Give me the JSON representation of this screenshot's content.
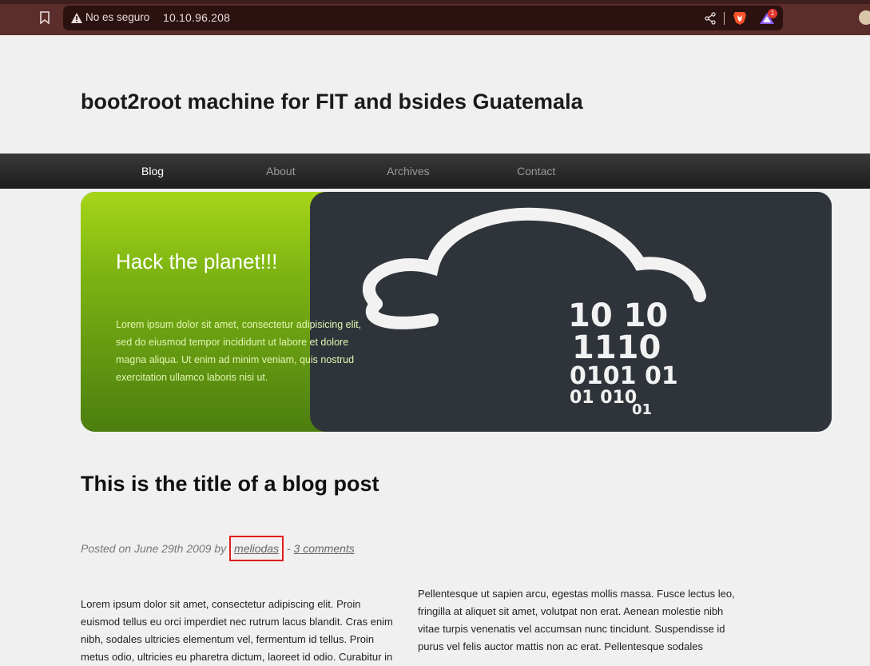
{
  "browser": {
    "security_label": "No es seguro",
    "url": "10.10.96.208",
    "rewards_count": "1"
  },
  "site": {
    "title": "boot2root machine for FIT and bsides Guatemala"
  },
  "nav": {
    "items": [
      {
        "label": "Blog",
        "active": true
      },
      {
        "label": "About"
      },
      {
        "label": "Archives"
      },
      {
        "label": "Contact"
      }
    ]
  },
  "banner": {
    "title": "Hack the planet!!!",
    "text": "Lorem ipsum dolor sit amet, consectetur adipisicing elit, sed do eiusmod tempor incididunt ut labore et dolore magna aliqua. Ut enim ad minim veniam, quis nostrud exercitation ullamco laboris nisi ut.",
    "binary_lines": [
      "10   10",
      "1110",
      "0101   01",
      "01         010",
      "01"
    ],
    "colors": {
      "green_top": "#a6d619",
      "green_bottom": "#4c7e10",
      "dark": "#2f343a"
    }
  },
  "post": {
    "title": "This is the title of a blog post",
    "meta_prefix": "Posted on June 29th 2009 by",
    "author": "meliodas",
    "separator": "-",
    "comments_label": "3 comments",
    "col1": "Lorem ipsum dolor sit amet, consectetur adipiscing elit. Proin euismod tellus eu orci imperdiet nec rutrum lacus blandit. Cras enim nibh, sodales ultricies elementum vel, fermentum id tellus. Proin metus odio, ultricies eu pharetra dictum, laoreet id odio. Curabitur in",
    "col2": "Pellentesque ut sapien arcu, egestas mollis massa. Fusce lectus leo, fringilla at aliquet sit amet, volutpat non erat. Aenean molestie nibh vitae turpis venenatis vel accumsan nunc tincidunt. Suspendisse id purus vel felis auctor mattis non ac erat. Pellentesque sodales"
  }
}
